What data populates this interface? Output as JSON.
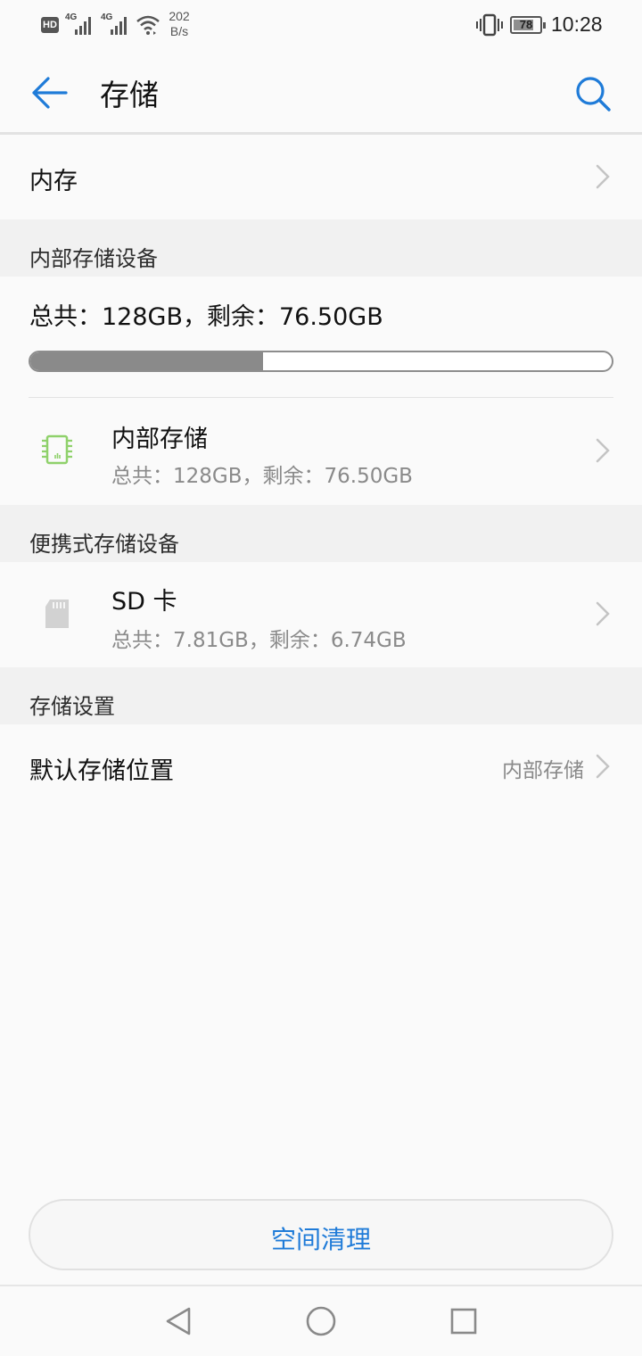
{
  "status_bar": {
    "hd": "HD",
    "network_1": "4G",
    "network_2": "4G",
    "speed_value": "202",
    "speed_unit": "B/s",
    "battery": "78",
    "time": "10:28"
  },
  "app_bar": {
    "title": "存储",
    "back_icon": "arrow-left-icon",
    "search_icon": "search-icon"
  },
  "memory_row": {
    "label": "内存"
  },
  "internal_section": {
    "header": "内部存储设备",
    "summary": "总共：128GB，剩余：76.50GB",
    "used_fraction": 0.4,
    "item": {
      "title": "内部存储",
      "subtitle": "总共：128GB，剩余：76.50GB",
      "icon": "chip-icon"
    }
  },
  "portable_section": {
    "header": "便携式存储设备",
    "item": {
      "title": "SD 卡",
      "subtitle": "总共：7.81GB，剩余：6.74GB",
      "icon": "sd-card-icon"
    }
  },
  "settings_section": {
    "header": "存储设置",
    "default_location": {
      "label": "默认存储位置",
      "value": "内部存储"
    }
  },
  "clean_button": {
    "label": "空间清理"
  },
  "colors": {
    "accent": "#1f7bd8",
    "chip_icon": "#8fd16b",
    "progress_fill": "#8a8a8a"
  }
}
